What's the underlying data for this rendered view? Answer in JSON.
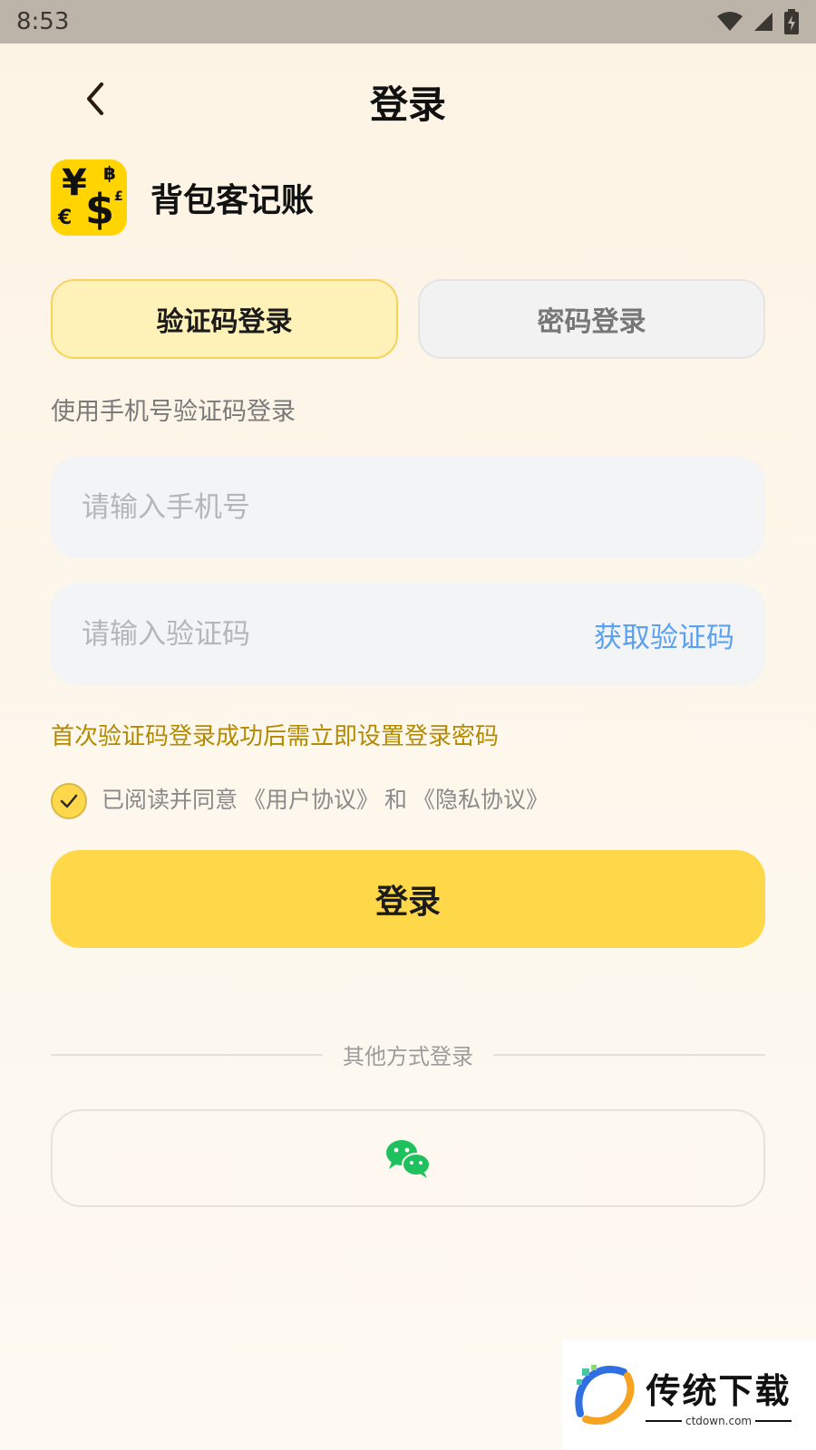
{
  "status_bar": {
    "time": "8:53"
  },
  "nav": {
    "title": "登录"
  },
  "brand": {
    "name": "背包客记账",
    "logo_symbols": [
      "¥",
      "฿",
      "£",
      "€",
      "$"
    ]
  },
  "tabs": [
    {
      "label": "验证码登录",
      "active": true
    },
    {
      "label": "密码登录",
      "active": false
    }
  ],
  "form": {
    "subtitle": "使用手机号验证码登录",
    "phone_placeholder": "请输入手机号",
    "code_placeholder": "请输入验证码",
    "get_code_label": "获取验证码",
    "hint": "首次验证码登录成功后需立即设置登录密码",
    "agreement": {
      "checked": true,
      "prefix": "已阅读并同意",
      "user_agreement": "《用户协议》",
      "and": "和",
      "privacy_agreement": "《隐私协议》"
    },
    "submit_label": "登录"
  },
  "other_login": {
    "divider_label": "其他方式登录",
    "wechat_icon": "wechat-icon"
  },
  "watermark": {
    "title": "传统下载",
    "sub": "ctdown.com"
  },
  "colors": {
    "accent": "#ffd84a",
    "active_tab_bg": "#fff2b8",
    "link_blue": "#5aa1f0",
    "hint_gold": "#b38a00",
    "wechat_green": "#1fc15e"
  }
}
